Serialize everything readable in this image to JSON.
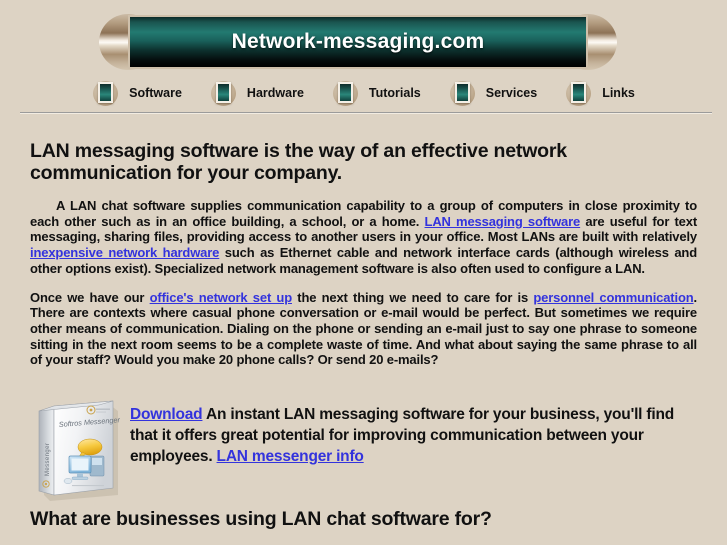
{
  "site": {
    "banner_title": "Network-messaging.com",
    "background_color": "#ddd3c4",
    "link_color": "#3333dd",
    "banner_accent_color": "#1d5e57"
  },
  "nav": {
    "items": [
      {
        "label": "Software",
        "icon": "book-icon"
      },
      {
        "label": "Hardware",
        "icon": "book-icon"
      },
      {
        "label": "Tutorials",
        "icon": "book-icon"
      },
      {
        "label": "Services",
        "icon": "book-icon"
      },
      {
        "label": "Links",
        "icon": "book-icon"
      }
    ]
  },
  "main": {
    "heading": "LAN messaging software is the way of an effective network communication for your company.",
    "paragraph1": {
      "part1": "A LAN chat software supplies communication capability to a group of computers in close proximity to each other such as in an office building, a school, or a home. ",
      "link1": "LAN messaging software",
      "part2": " are useful for text messaging, sharing files, providing access to another users in your office. Most LANs are built with relatively ",
      "link2": "inexpensive network hardware",
      "part3": " such as Ethernet cable and network interface cards (although wireless and other options exist). Specialized network management software is also often used to configure a LAN."
    },
    "paragraph2": {
      "part1": "Once we have our ",
      "link1": "office's network set up",
      "part2": " the next thing we need to care for is ",
      "link2": "personnel communication",
      "part3": ". There are contexts where casual phone conversation or e-mail would be perfect. But sometimes we require other means of communication. Dialing on the phone or sending an e-mail just to say one phrase to someone sitting in the next room seems to be a complete waste of time. And what about saying the same phrase to all of your staff? Would you make 20 phone calls? Or send 20 e-mails?"
    },
    "download": {
      "box_product_name": "Softros Messenger",
      "box_spine_text": "Messenger",
      "link_download": "Download",
      "text1": " An instant LAN messaging software for your business, you'll find that it offers great potential for improving communication between your employees. ",
      "link_info": "LAN messenger info"
    },
    "section_heading": "What are businesses using LAN chat software for?"
  }
}
